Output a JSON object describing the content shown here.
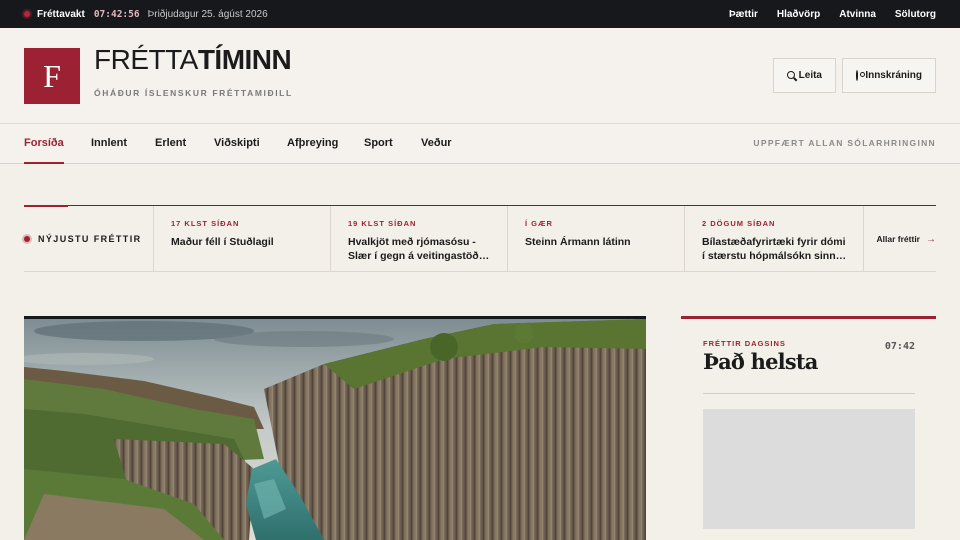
{
  "topbar": {
    "live_label": "Fréttavakt",
    "time": "07:42:56",
    "date": "Þriðjudagur 25. ágúst 2026",
    "links": [
      "Þættir",
      "Hlaðvörp",
      "Atvinna",
      "Sölutorg"
    ]
  },
  "header": {
    "logo_letter": "F",
    "brand_part1": "FRÉTTA",
    "brand_part2": "TÍMINN",
    "tagline": "ÓHÁÐUR ÍSLENSKUR FRÉTTAMIÐILL",
    "search_label": "Leita",
    "login_label": "Innskráning"
  },
  "nav": {
    "items": [
      "Forsíða",
      "Innlent",
      "Erlent",
      "Viðskipti",
      "Afþreying",
      "Sport",
      "Veður"
    ],
    "note": "UPPFÆRT ALLAN SÓLARHRINGINN"
  },
  "latest": {
    "label": "NÝJUSTU FRÉTTIR",
    "items": [
      {
        "time": "17 KLST SÍÐAN",
        "title": "Maður féll í Stuðlagil"
      },
      {
        "time": "19 KLST SÍÐAN",
        "title": "Hvalkjöt með rjómasósu - Slær í gegn á veitingastöð…"
      },
      {
        "time": "Í GÆR",
        "title": "Steinn Ármann látinn"
      },
      {
        "time": "2 DÖGUM SÍÐAN",
        "title": "Bílastæðafyrirtæki fyrir dómi í stærstu hópmálsókn sinn…"
      }
    ],
    "all_label": "Allar fréttir"
  },
  "sidebar": {
    "kicker": "FRÉTTIR DAGSINS",
    "title": "Það helsta",
    "time": "07:42"
  },
  "colors": {
    "accent": "#9c2233",
    "topbar": "#17181c",
    "background": "#f3efe9"
  }
}
